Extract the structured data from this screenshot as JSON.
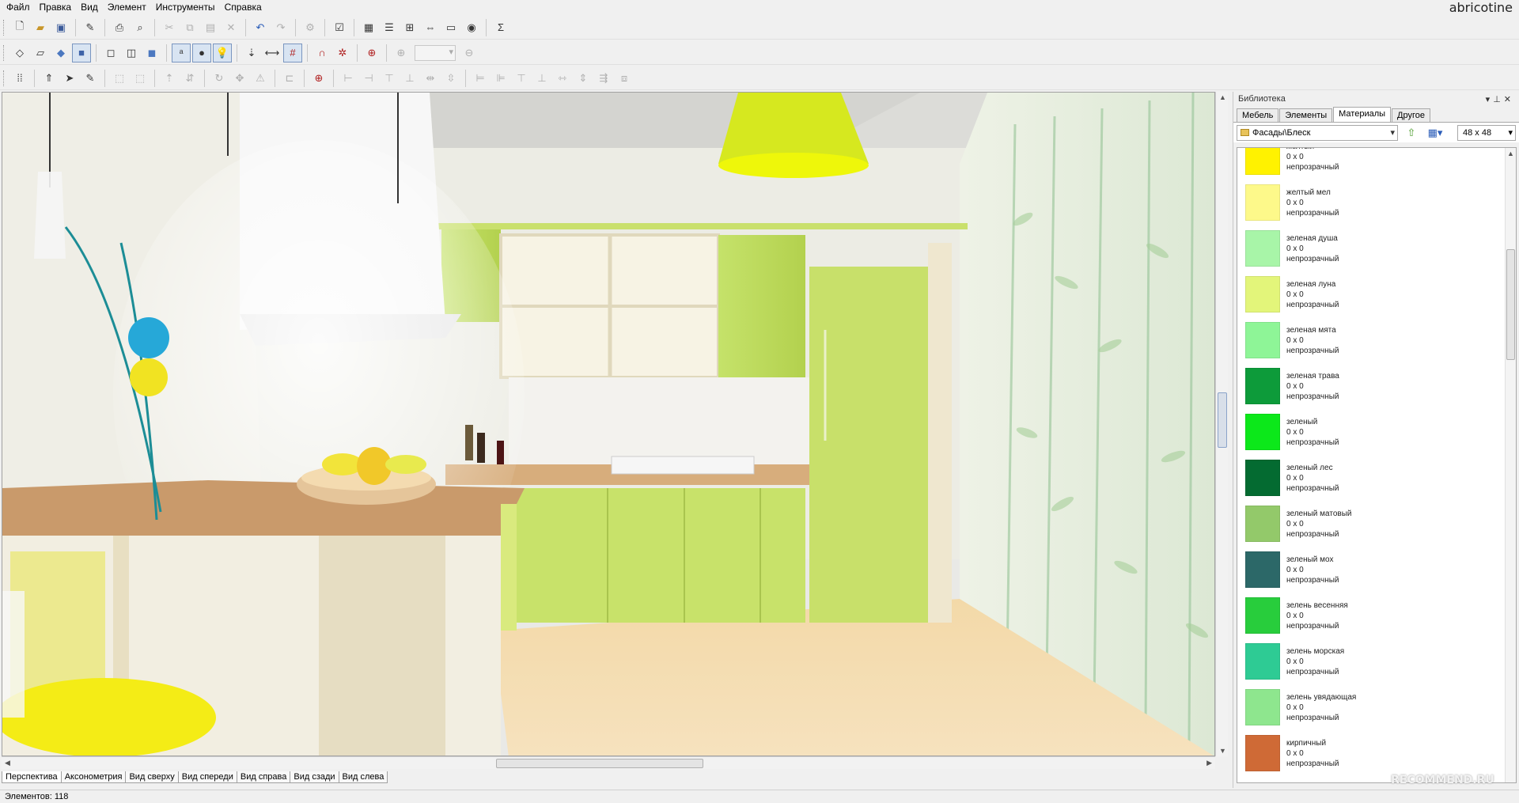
{
  "menu": [
    "Файл",
    "Правка",
    "Вид",
    "Элемент",
    "Инструменты",
    "Справка"
  ],
  "watermark_top": "abricotine",
  "toolbar1_icons": [
    "new-file-icon",
    "open-folder-icon",
    "save-icon",
    "edit-icon",
    "print-icon",
    "print-preview-icon",
    "cut-icon",
    "copy-icon",
    "paste-icon",
    "delete-icon",
    "undo-icon",
    "redo-icon",
    "properties-icon",
    "report-icon",
    "catalog-icon",
    "list-icon",
    "dimension-icon",
    "export-icon",
    "render-icon",
    "sum-icon"
  ],
  "library": {
    "title": "Библиотека",
    "tabs": [
      "Мебель",
      "Элементы",
      "Материалы",
      "Другое"
    ],
    "active_tab": "Материалы",
    "path": "Фасады\\Блеск",
    "size": "48 x 48",
    "materials": [
      {
        "name": "желтый",
        "size": "0 x 0",
        "kind": "непрозрачный",
        "color": "#fff200"
      },
      {
        "name": "желтый мел",
        "size": "0 x 0",
        "kind": "непрозрачный",
        "color": "#fdf98a"
      },
      {
        "name": "зеленая душа",
        "size": "0 x 0",
        "kind": "непрозрачный",
        "color": "#a8f5a8"
      },
      {
        "name": "зеленая луна",
        "size": "0 x 0",
        "kind": "непрозрачный",
        "color": "#e3f57a"
      },
      {
        "name": "зеленая мята",
        "size": "0 x 0",
        "kind": "непрозрачный",
        "color": "#8ef597"
      },
      {
        "name": "зеленая трава",
        "size": "0 x 0",
        "kind": "непрозрачный",
        "color": "#0d9b3a"
      },
      {
        "name": "зеленый",
        "size": "0 x 0",
        "kind": "непрозрачный",
        "color": "#0ce81a"
      },
      {
        "name": "зеленый лес",
        "size": "0 x 0",
        "kind": "непрозрачный",
        "color": "#046b31"
      },
      {
        "name": "зеленый матовый",
        "size": "0 x 0",
        "kind": "непрозрачный",
        "color": "#93c96a"
      },
      {
        "name": "зеленый мох",
        "size": "0 x 0",
        "kind": "непрозрачный",
        "color": "#2c6868"
      },
      {
        "name": "зелень весенняя",
        "size": "0 x 0",
        "kind": "непрозрачный",
        "color": "#28cd3c"
      },
      {
        "name": "зелень морская",
        "size": "0 x 0",
        "kind": "непрозрачный",
        "color": "#2ecb94"
      },
      {
        "name": "зелень увядающая",
        "size": "0 x 0",
        "kind": "непрозрачный",
        "color": "#8ee68e"
      },
      {
        "name": "кирпичный",
        "size": "0 x 0",
        "kind": "непрозрачный",
        "color": "#cf6a36"
      }
    ]
  },
  "view_tabs": [
    "Перспектива",
    "Аксонометрия",
    "Вид сверху",
    "Вид спереди",
    "Вид справа",
    "Вид сзади",
    "Вид слева"
  ],
  "active_view": "Перспектива",
  "status": "Элементов: 118",
  "watermark_bottom": "RECOMMEND.RU"
}
